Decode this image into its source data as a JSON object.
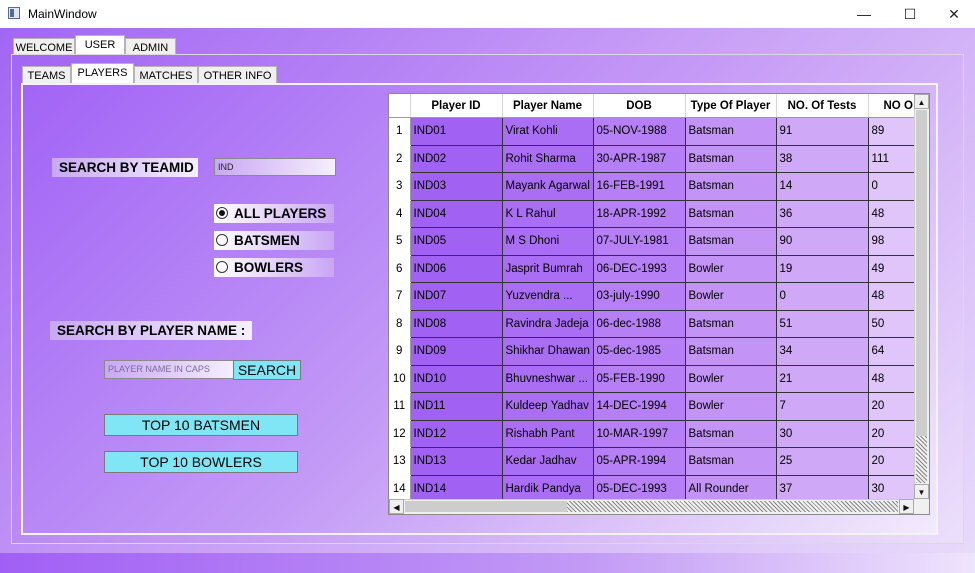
{
  "window": {
    "title": "MainWindow",
    "minimize": "—",
    "maximize": "☐",
    "close": "✕"
  },
  "top_tabs": [
    "WELCOME",
    "USER",
    "ADMIN"
  ],
  "sub_tabs": [
    "TEAMS",
    "PLAYERS",
    "MATCHES",
    "OTHER INFO"
  ],
  "search_team": {
    "label": "SEARCH BY TEAMID",
    "value": "IND"
  },
  "radios": [
    {
      "label": "ALL PLAYERS",
      "checked": true
    },
    {
      "label": "BATSMEN",
      "checked": false
    },
    {
      "label": "BOWLERS",
      "checked": false
    }
  ],
  "search_player": {
    "label": "SEARCH BY PLAYER NAME :",
    "placeholder": "PLAYER NAME IN CAPS",
    "button": "SEARCH"
  },
  "buttons": {
    "top_batsmen": "TOP 10 BATSMEN",
    "top_bowlers": "TOP 10 BOWLERS"
  },
  "grid": {
    "columns": [
      "Player ID",
      "Player Name",
      "DOB",
      "Type Of Player",
      "NO. Of Tests",
      "NO O"
    ],
    "rows": [
      [
        "1",
        "IND01",
        "Virat Kohli",
        "05-NOV-1988",
        "Batsman",
        "91",
        "89"
      ],
      [
        "2",
        "IND02",
        "Rohit Sharma",
        "30-APR-1987",
        "Batsman",
        "38",
        "111"
      ],
      [
        "3",
        "IND03",
        "Mayank Agarwal",
        "16-FEB-1991",
        "Batsman",
        "14",
        "0"
      ],
      [
        "4",
        "IND04",
        "K L Rahul",
        "18-APR-1992",
        "Batsman",
        "36",
        "48"
      ],
      [
        "5",
        "IND05",
        "M S Dhoni",
        "07-JULY-1981",
        "Batsman",
        "90",
        "98"
      ],
      [
        "6",
        "IND06",
        "Jasprit Bumrah",
        "06-DEC-1993",
        "Bowler",
        "19",
        "49"
      ],
      [
        "7",
        "IND07",
        "Yuzvendra ...",
        "03-july-1990",
        "Bowler",
        "0",
        "48"
      ],
      [
        "8",
        "IND08",
        "Ravindra Jadeja",
        "06-dec-1988",
        "Batsman",
        "51",
        "50"
      ],
      [
        "9",
        "IND09",
        "Shikhar Dhawan",
        "05-dec-1985",
        "Batsman",
        "34",
        "64"
      ],
      [
        "10",
        "IND10",
        "Bhuvneshwar ...",
        "05-FEB-1990",
        "Bowler",
        "21",
        "48"
      ],
      [
        "11",
        "IND11",
        "Kuldeep Yadhav",
        "14-DEC-1994",
        "Bowler",
        "7",
        "20"
      ],
      [
        "12",
        "IND12",
        "Rishabh Pant",
        "10-MAR-1997",
        "Batsman",
        "30",
        "20"
      ],
      [
        "13",
        "IND13",
        "Kedar Jadhav",
        "05-APR-1994",
        "Batsman",
        "25",
        "20"
      ],
      [
        "14",
        "IND14",
        "Hardik Pandya",
        "05-DEC-1993",
        "All Rounder",
        "37",
        "30"
      ]
    ]
  },
  "scroll_arrows": {
    "up": "▲",
    "down": "▼",
    "left": "◀",
    "right": "▶"
  }
}
